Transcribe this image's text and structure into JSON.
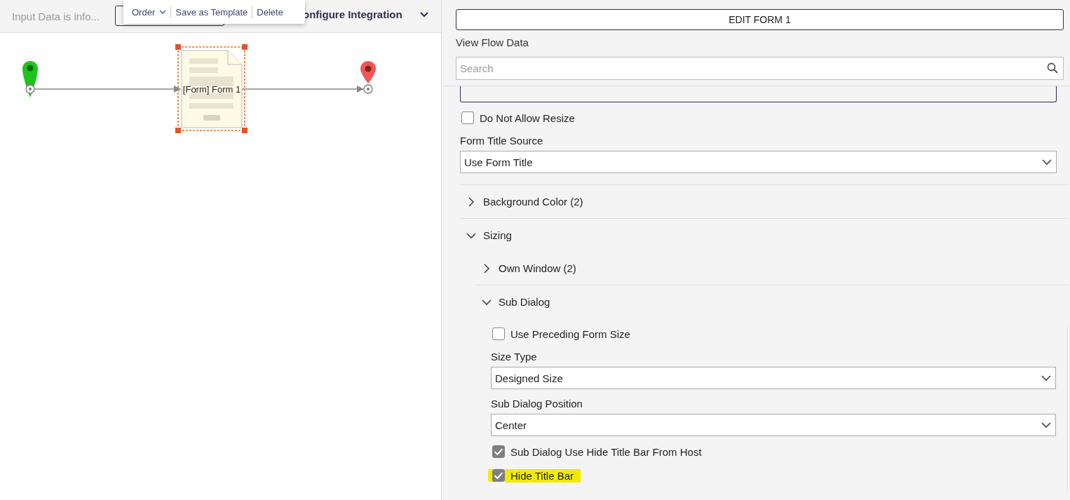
{
  "toolbar": {
    "status_text": "Input Data is info...",
    "configure_label": "onfigure Integration"
  },
  "context_menu": {
    "items": [
      {
        "label": "Order",
        "kind": "dropdown"
      },
      {
        "label": "Save as Template",
        "kind": "plain"
      },
      {
        "label": "Delete",
        "kind": "plain"
      }
    ]
  },
  "flow": {
    "node_label": "[Form] Form 1",
    "node_selected": true
  },
  "panel": {
    "edit_button": "EDIT FORM 1",
    "view_link": "View Flow Data",
    "search": {
      "placeholder": "Search"
    },
    "settings": [
      {
        "kind": "checkbox",
        "label": "Do Not Allow Resize",
        "checked": false
      },
      {
        "kind": "select",
        "label": "Form Title Source",
        "value": "Use Form Title"
      },
      {
        "kind": "section",
        "label": "Background Color (2)",
        "expanded": false
      },
      {
        "kind": "section",
        "label": "Sizing",
        "expanded": true,
        "children": [
          {
            "kind": "section",
            "label": "Own Window (2)",
            "expanded": false
          },
          {
            "kind": "section",
            "label": "Sub Dialog",
            "expanded": true,
            "children": [
              {
                "kind": "checkbox",
                "label": "Use Preceding Form Size",
                "checked": false
              },
              {
                "kind": "select",
                "label": "Size Type",
                "value": "Designed Size"
              },
              {
                "kind": "select",
                "label": "Sub Dialog Position",
                "value": "Center"
              },
              {
                "kind": "checkbox",
                "label": "Sub Dialog Use Hide Title Bar From Host",
                "checked": true
              },
              {
                "kind": "checkbox",
                "label": "Hide Title Bar",
                "checked": true,
                "highlighted": true
              }
            ]
          }
        ]
      }
    ]
  }
}
